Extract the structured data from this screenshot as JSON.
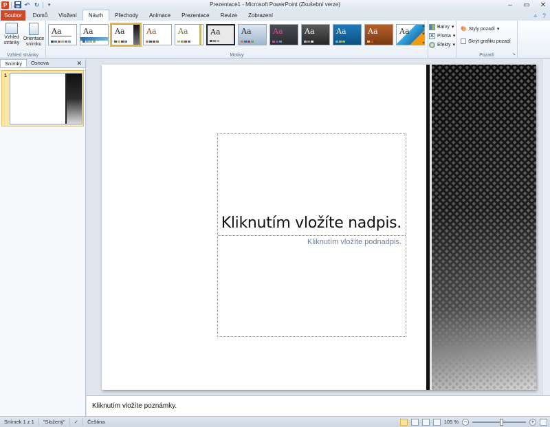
{
  "window": {
    "title": "Prezentace1  -  Microsoft PowerPoint (Zkušební verze)",
    "app_icon_letter": "P"
  },
  "tabs": [
    {
      "label": "Soubor"
    },
    {
      "label": "Domů"
    },
    {
      "label": "Vložení"
    },
    {
      "label": "Návrh"
    },
    {
      "label": "Přechody"
    },
    {
      "label": "Animace"
    },
    {
      "label": "Prezentace"
    },
    {
      "label": "Revize"
    },
    {
      "label": "Zobrazení"
    }
  ],
  "ribbon": {
    "page_setup": {
      "setup_label": "Vzhled stránky",
      "orientation_label": "Orientace snímku",
      "group_label": "Vzhled stránky"
    },
    "themes": {
      "group_label": "Motivy",
      "theme_glyph": "Aa"
    },
    "theme_options": {
      "colors": "Barvy",
      "fonts": "Písma",
      "effects": "Efekty"
    },
    "background": {
      "styles": "Styly pozadí",
      "hide_graphics": "Skrýt grafiku pozadí",
      "group_label": "Pozadí"
    }
  },
  "left_pane": {
    "tab_slides": "Snímky",
    "tab_outline": "Osnova",
    "slide_number": "1"
  },
  "slide": {
    "title_placeholder": "Kliknutím vložíte nadpis.",
    "subtitle_placeholder": "Kliknutím vložíte podnadpis."
  },
  "notes": {
    "placeholder": "Kliknutím vložíte poznámky."
  },
  "status_bar": {
    "slide_info": "Snímek 1 z 1",
    "theme_name": "\"Složený\"",
    "language": "Čeština",
    "zoom": "105 %"
  },
  "colors": {
    "file_tab": "#d24726",
    "selected_highlight": "#fbe7a3"
  }
}
